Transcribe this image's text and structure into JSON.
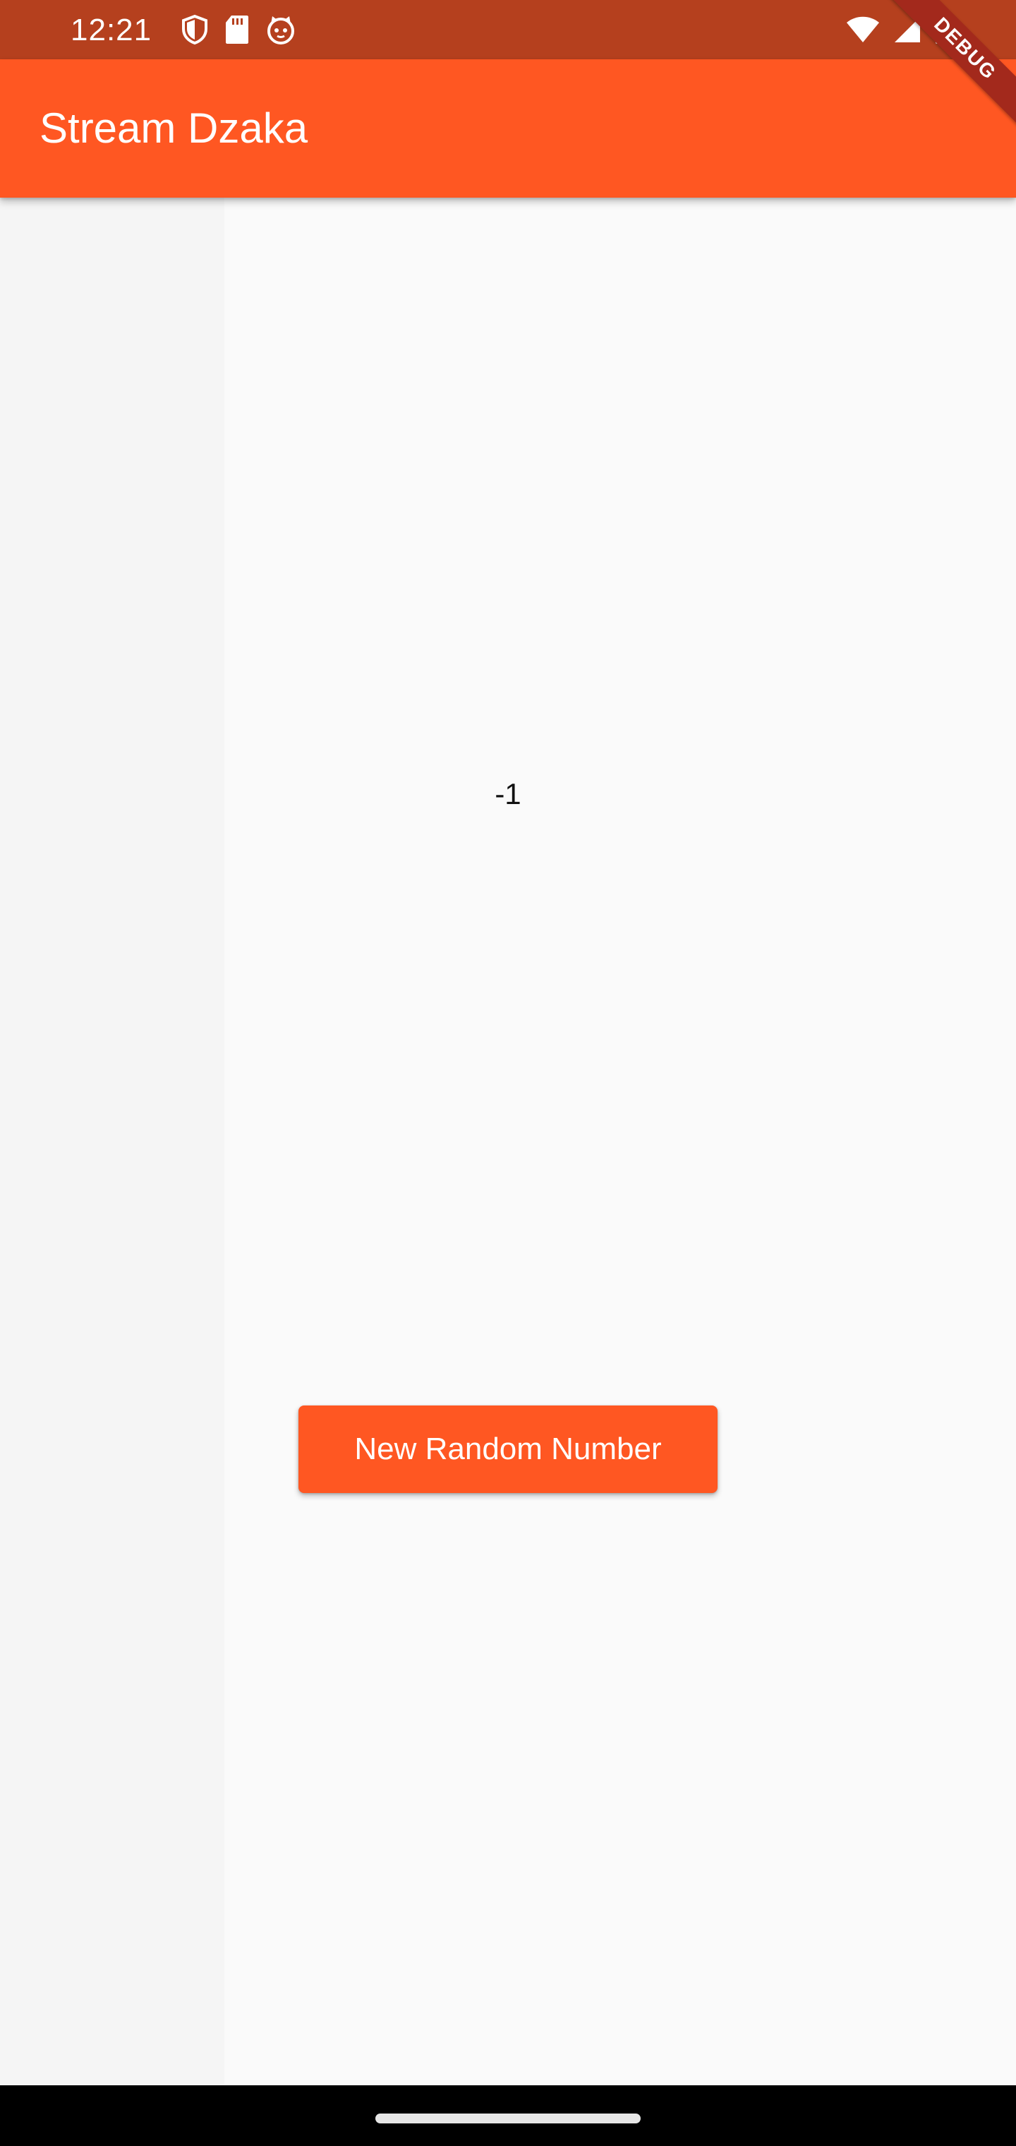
{
  "status_bar": {
    "time": "12:21",
    "left_icons": [
      "shield-icon",
      "sd-card-icon",
      "cat-face-icon"
    ],
    "right_icons": [
      "wifi-icon",
      "cell-signal-icon",
      "battery-icon"
    ]
  },
  "app_bar": {
    "title": "Stream Dzaka",
    "color": "#ff5722"
  },
  "debug_banner": "DEBUG",
  "main": {
    "number": "-1",
    "button_label": "New Random Number"
  },
  "colors": {
    "primary": "#ff5722",
    "status_bar": "#b5401e",
    "background": "#fafafa"
  }
}
